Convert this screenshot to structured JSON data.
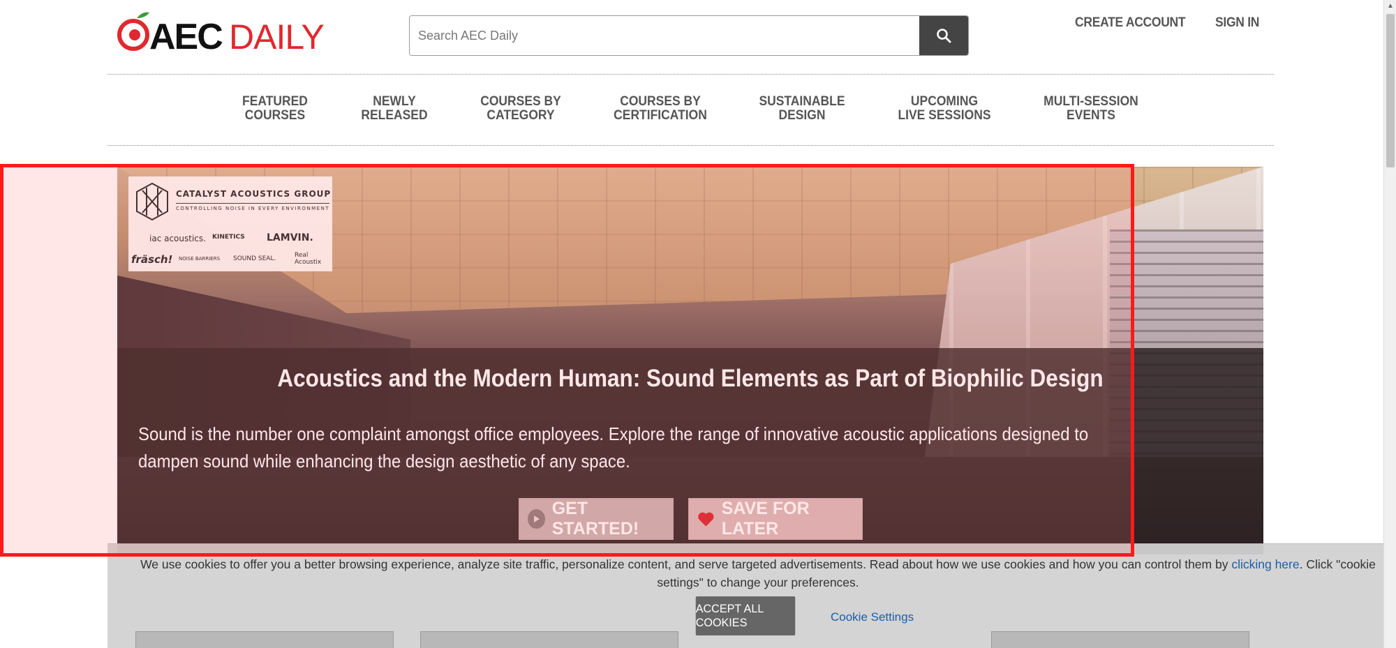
{
  "header": {
    "logo_text": "@AECDAILY",
    "search": {
      "placeholder": "Search AEC Daily"
    },
    "links": [
      "CREATE ACCOUNT",
      "SIGN IN"
    ]
  },
  "nav": {
    "items": [
      "FEATURED\nCOURSES",
      "NEWLY\nRELEASED",
      "COURSES BY\nCATEGORY",
      "COURSES BY\nCERTIFICATION",
      "SUSTAINABLE\nDESIGN",
      "UPCOMING\nLIVE SESSIONS",
      "MULTI-SESSION\nEVENTS"
    ]
  },
  "hero": {
    "sponsor": {
      "title": "CATALYST ACOUSTICS GROUP",
      "tagline": "CONTROLLING NOISE IN EVERY ENVIRONMENT",
      "brands": [
        "iac acoustics.",
        "KINETICS",
        "LAMVIN.",
        "fräsch!",
        "NOISE BARRIERS",
        "SOUND SEAL.",
        "Real Acoustix"
      ]
    },
    "title": "Acoustics and the Modern Human: Sound Elements as Part of Biophilic Design",
    "description": "Sound is the number one complaint amongst office employees. Explore the range of innovative acoustic applications designed to dampen sound while enhancing the design aesthetic of any space.",
    "get_started_label": "GET STARTED!",
    "save_label": "SAVE FOR LATER"
  },
  "cookie": {
    "text_before": " We use cookies to offer you a better browsing experience, analyze site traffic, personalize content, and serve targeted advertisements. Read about how we use cookies and how you can control them by ",
    "link_text": "clicking here",
    "text_after": ". Click \"cookie settings\" to change your preferences.",
    "accept_label": "ACCEPT ALL COOKIES",
    "settings_label": "Cookie Settings"
  },
  "colors": {
    "logo_red": "#e0282e",
    "link_blue": "#1a5fa8",
    "highlight_red": "#ff1a1a"
  }
}
